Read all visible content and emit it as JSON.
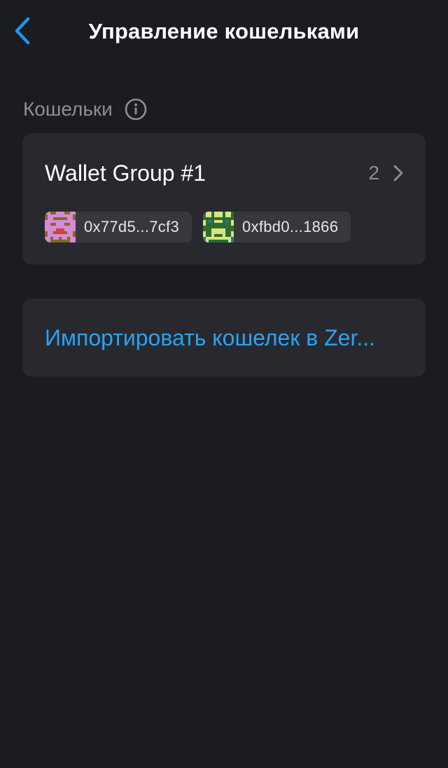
{
  "header": {
    "title": "Управление кошельками",
    "back_icon": "chevron-left-icon",
    "accent_color": "#1e96ee"
  },
  "section": {
    "label": "Кошельки",
    "info_icon": "info-icon"
  },
  "wallet_group": {
    "name": "Wallet Group #1",
    "count": "2",
    "chevron_icon": "chevron-right-icon",
    "addresses": [
      {
        "short": "0x77d5...7cf3",
        "avatar_colors": [
          "#d98ad2",
          "#7d6a2a"
        ]
      },
      {
        "short": "0xfbd0...1866",
        "avatar_colors": [
          "#d9e67a",
          "#2e6b34"
        ]
      }
    ]
  },
  "import": {
    "label": "Импортировать кошелек в Zer...",
    "color": "#2aa3f2"
  }
}
